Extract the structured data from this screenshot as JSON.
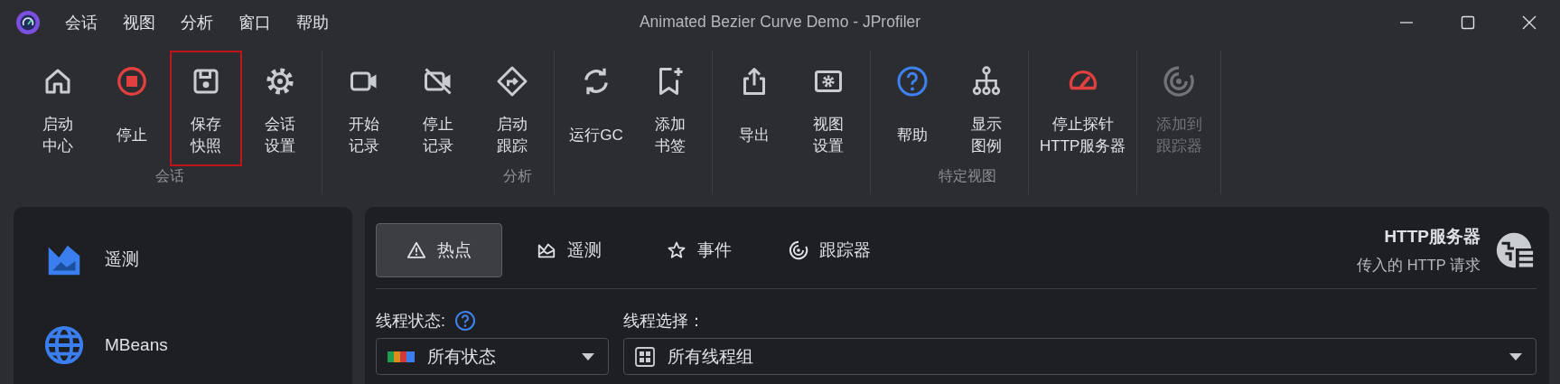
{
  "window": {
    "title": "Animated Bezier Curve Demo - JProfiler"
  },
  "menu": [
    {
      "label": "会话"
    },
    {
      "label": "视图"
    },
    {
      "label": "分析"
    },
    {
      "label": "窗口"
    },
    {
      "label": "帮助"
    }
  ],
  "toolbar": {
    "groups": [
      {
        "label": "会话",
        "sections": [
          [
            {
              "kind": "home",
              "label": "启动中心",
              "selected": false,
              "disabled": false
            },
            {
              "kind": "stop",
              "label": "停止",
              "selected": false,
              "disabled": false
            },
            {
              "kind": "save",
              "label": "保存快照",
              "selected": true,
              "disabled": false
            },
            {
              "kind": "gear",
              "label": "会话设置",
              "selected": false,
              "disabled": false
            }
          ]
        ]
      },
      {
        "label": "分析",
        "sections": [
          [
            {
              "kind": "video",
              "label": "开始记录",
              "selected": false,
              "disabled": false
            },
            {
              "kind": "video-off",
              "label": "停止记录",
              "selected": false,
              "disabled": false
            },
            {
              "kind": "route",
              "label": "启动跟踪",
              "selected": false,
              "disabled": false
            }
          ],
          [
            {
              "kind": "refresh",
              "label": "运行GC",
              "selected": false,
              "disabled": false
            },
            {
              "kind": "bookmark-add",
              "label": "添加书签",
              "selected": false,
              "disabled": false
            }
          ]
        ]
      },
      {
        "label": "特定视图",
        "sections": [
          [
            {
              "kind": "export",
              "label": "导出",
              "selected": false,
              "disabled": false
            },
            {
              "kind": "view-settings",
              "label": "视图设置",
              "selected": false,
              "disabled": false
            }
          ],
          [
            {
              "kind": "help",
              "label": "帮助",
              "selected": false,
              "disabled": false
            },
            {
              "kind": "hierarchy",
              "label": "显示图例",
              "selected": false,
              "disabled": false
            }
          ],
          [
            {
              "kind": "gauge",
              "label": "停止探针\nHTTP服务器",
              "selected": false,
              "disabled": false
            }
          ],
          [
            {
              "kind": "tracker",
              "label": "添加到跟踪器",
              "selected": false,
              "disabled": true
            }
          ]
        ]
      }
    ]
  },
  "sidebar": {
    "items": [
      {
        "kind": "telemetry",
        "label": "遥测"
      },
      {
        "kind": "globe",
        "label": "MBeans"
      }
    ]
  },
  "tabs": [
    {
      "kind": "warning",
      "label": "热点",
      "selected": true
    },
    {
      "kind": "telemetry",
      "label": "遥测",
      "selected": false
    },
    {
      "kind": "star",
      "label": "事件",
      "selected": false
    },
    {
      "kind": "tracker",
      "label": "跟踪器",
      "selected": false
    }
  ],
  "header": {
    "title": "HTTP服务器",
    "subtitle": "传入的 HTTP 请求"
  },
  "filters": [
    {
      "label": "线程状态:",
      "help": true,
      "kind": "states",
      "value": "所有状态"
    },
    {
      "label": "线程选择：",
      "help": false,
      "kind": "groups",
      "value": "所有线程组"
    }
  ]
}
